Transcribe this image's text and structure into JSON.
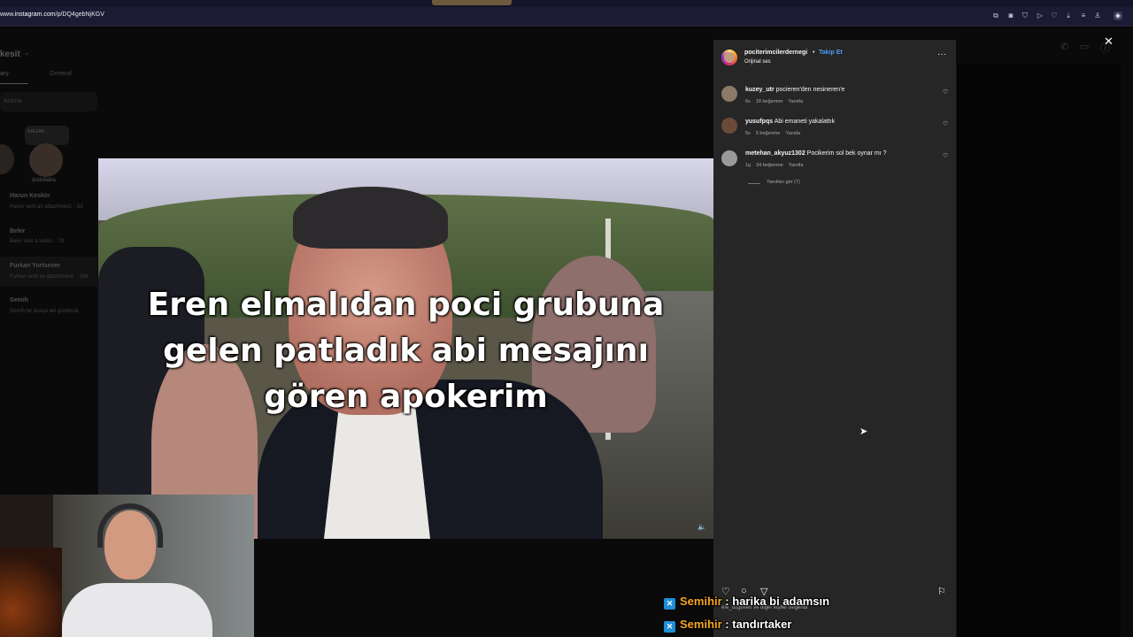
{
  "browser": {
    "url_prefix": "www.",
    "url_host": "instagram.com",
    "url_path": "/p/DQ4gebNjKGV",
    "toolbar_icons": [
      "share-icon",
      "camera-icon",
      "shield-icon",
      "send-icon",
      "heart-icon",
      "download-icon",
      "menu-icon",
      "account-icon",
      "extension-icon"
    ]
  },
  "dm_background": {
    "title": "kesit",
    "tabs": [
      "ary",
      "General"
    ],
    "search_placeholder": "Arama",
    "note_text": "KALEIM...",
    "avatar_name": "dodobaba",
    "threads": [
      {
        "name": "Harun Keskin",
        "preview": "Harun sent an attachment. · 5d"
      },
      {
        "name": "Bekir",
        "preview": "Bekir sent a video. · 7d"
      },
      {
        "name": "Furkan Yurtsever",
        "preview": "Furkan sent an attachment. · 10d"
      },
      {
        "name": "Semih",
        "preview": "Semih bir dosya eki gönderdi."
      }
    ]
  },
  "video": {
    "caption_lines": [
      "Eren elmalıdan poci grubuna",
      "gelen patladık abi mesajını",
      "gören apokerim"
    ]
  },
  "post": {
    "username": "pociterimcilerdernegi",
    "separator": "•",
    "follow_label": "Takip Et",
    "audio": "Orijinal ses",
    "comments": [
      {
        "user": "kuzey_utr",
        "text": "pocieren'den nesineren'e",
        "time": "6s",
        "likes": "18 beğenme",
        "reply": "Yanıtla",
        "avatar_color": "#8a7a66"
      },
      {
        "user": "yusufpqs",
        "text": "Abi emaneti yakalattık",
        "time": "5s",
        "likes": "5 beğenme",
        "reply": "Yanıtla",
        "avatar_color": "#6b4a3a"
      },
      {
        "user": "metehan_akyuz1302",
        "text": "Pocikerim sol bek oynar mı ?",
        "time": "1g",
        "likes": "34 beğenme",
        "reply": "Yanıtla",
        "avatar_color": "#9a9a9a"
      }
    ],
    "view_replies": "Yanıtları gör (7)",
    "liked_by": "efe_ozguven ve diğer kişiler beğendi"
  },
  "chat": [
    {
      "user": "Semihir",
      "separator": " : ",
      "message": "harika bi adamsın"
    },
    {
      "user": "Semihir",
      "separator": " : ",
      "message": "tandırtaker"
    }
  ]
}
